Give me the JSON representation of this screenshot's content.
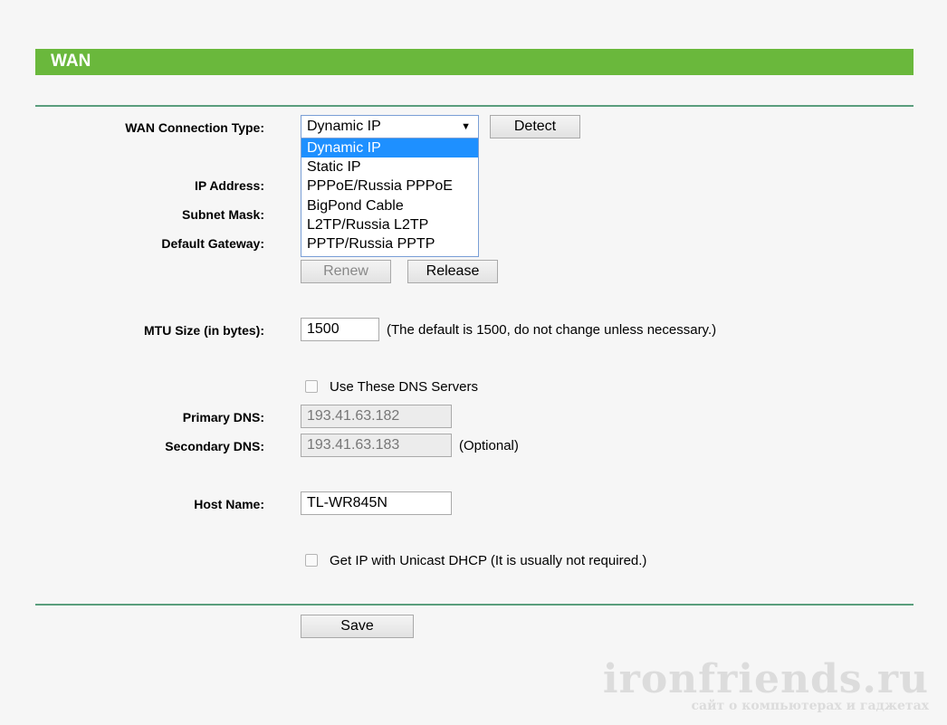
{
  "header": {
    "title": "WAN"
  },
  "form": {
    "connection_type_label": "WAN Connection Type:",
    "connection_type_value": "Dynamic IP",
    "connection_options": [
      "Dynamic IP",
      "Static IP",
      "PPPoE/Russia PPPoE",
      "BigPond Cable",
      "L2TP/Russia L2TP",
      "PPTP/Russia PPTP"
    ],
    "detect_label": "Detect",
    "ip_address_label": "IP Address:",
    "subnet_mask_label": "Subnet Mask:",
    "default_gateway_label": "Default Gateway:",
    "renew_label": "Renew",
    "release_label": "Release",
    "mtu_label": "MTU Size (in bytes):",
    "mtu_value": "1500",
    "mtu_note": "(The default is 1500, do not change unless necessary.)",
    "dns_checkbox_label": "Use These DNS Servers",
    "dns_checked": false,
    "primary_dns_label": "Primary DNS:",
    "primary_dns_value": "193.41.63.182",
    "secondary_dns_label": "Secondary DNS:",
    "secondary_dns_value": "193.41.63.183",
    "optional_note": "(Optional)",
    "host_name_label": "Host Name:",
    "host_name_value": "TL-WR845N",
    "unicast_label": "Get IP with Unicast DHCP (It is usually not required.)",
    "unicast_checked": false,
    "save_label": "Save"
  },
  "watermark": {
    "title": "ironfriends.ru",
    "subtitle": "сайт о компьютерах и гаджетах"
  },
  "colors": {
    "header_bg": "#6ab83c",
    "rule": "#5a9e7d",
    "selected_option": "#1e90ff"
  }
}
